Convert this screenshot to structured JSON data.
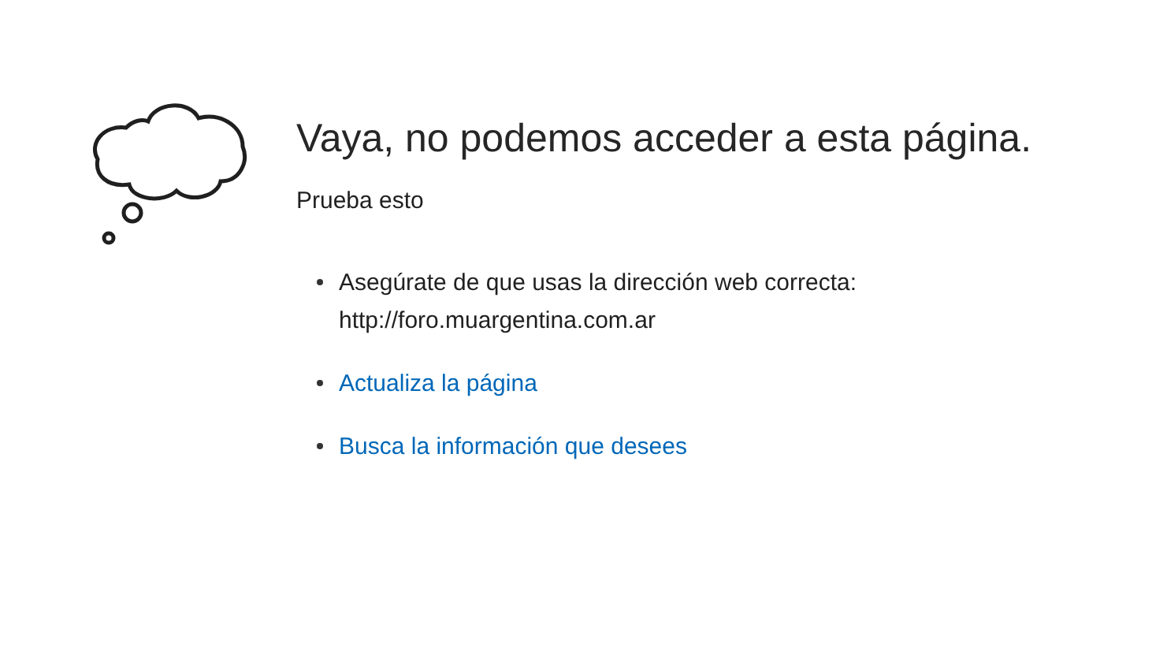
{
  "heading": "Vaya, no podemos acceder a esta página.",
  "subheading": "Prueba esto",
  "suggestions": [
    {
      "kind": "text",
      "lines": [
        "Asegúrate de que usas la dirección web correcta:",
        "http://foro.muargentina.com.ar"
      ]
    },
    {
      "kind": "link",
      "lines": [
        "Actualiza la página"
      ]
    },
    {
      "kind": "link",
      "lines": [
        "Busca la información que desees"
      ]
    }
  ]
}
